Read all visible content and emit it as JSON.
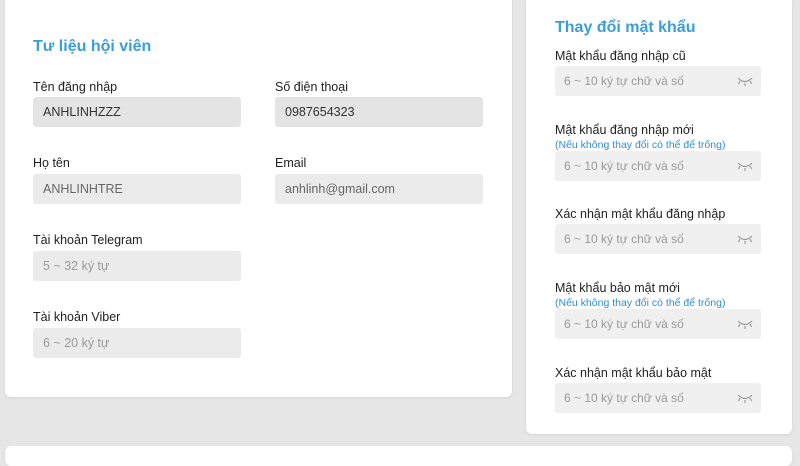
{
  "profile": {
    "title": "Tư liệu hội viên",
    "fields": {
      "username": {
        "label": "Tên đăng nhập",
        "value": "ANHLINHZZZ"
      },
      "phone": {
        "label": "Số điện thoại",
        "value": "0987654323"
      },
      "fullname": {
        "label": "Họ tên",
        "value": "ANHLINHTRE"
      },
      "email": {
        "label": "Email",
        "value": "anhlinh@gmail.com"
      },
      "telegram": {
        "label": "Tài khoản Telegram",
        "placeholder": "5 ~ 32 ký tự"
      },
      "viber": {
        "label": "Tài khoản Viber",
        "placeholder": "6 ~ 20 ký tự"
      }
    }
  },
  "password": {
    "title": "Thay đổi mật khẩu",
    "fields": [
      {
        "label": "Mật khẩu đăng nhập cũ",
        "hint": "",
        "placeholder": "6 ~ 10 ký tự chữ và số",
        "icon": "eye-closed-icon"
      },
      {
        "label": "Mật khẩu đăng nhập mới",
        "hint": "(Nếu không thay đổi có thể để trống)",
        "placeholder": "6 ~ 10 ký tự chữ và số",
        "icon": "eye-closed-icon"
      },
      {
        "label": "Xác nhận mật khẩu đăng nhập",
        "hint": "",
        "placeholder": "6 ~ 10 ký tự chữ và số",
        "icon": "eye-closed-icon"
      },
      {
        "label": "Mật khẩu bảo mật mới",
        "hint": "(Nếu không thay đổi có thể để trống)",
        "placeholder": "6 ~ 10 ký tự chữ và số",
        "icon": "eye-closed-icon"
      },
      {
        "label": "Xác nhận mật khẩu bảo mật",
        "hint": "",
        "placeholder": "6 ~ 10 ký tự chữ và số",
        "icon": "eye-closed-icon"
      }
    ]
  },
  "colors": {
    "accent": "#3a9ed8",
    "hint": "#2f8ed0",
    "field_bg": "#ebebeb",
    "page_bg": "#e6e6e6"
  }
}
